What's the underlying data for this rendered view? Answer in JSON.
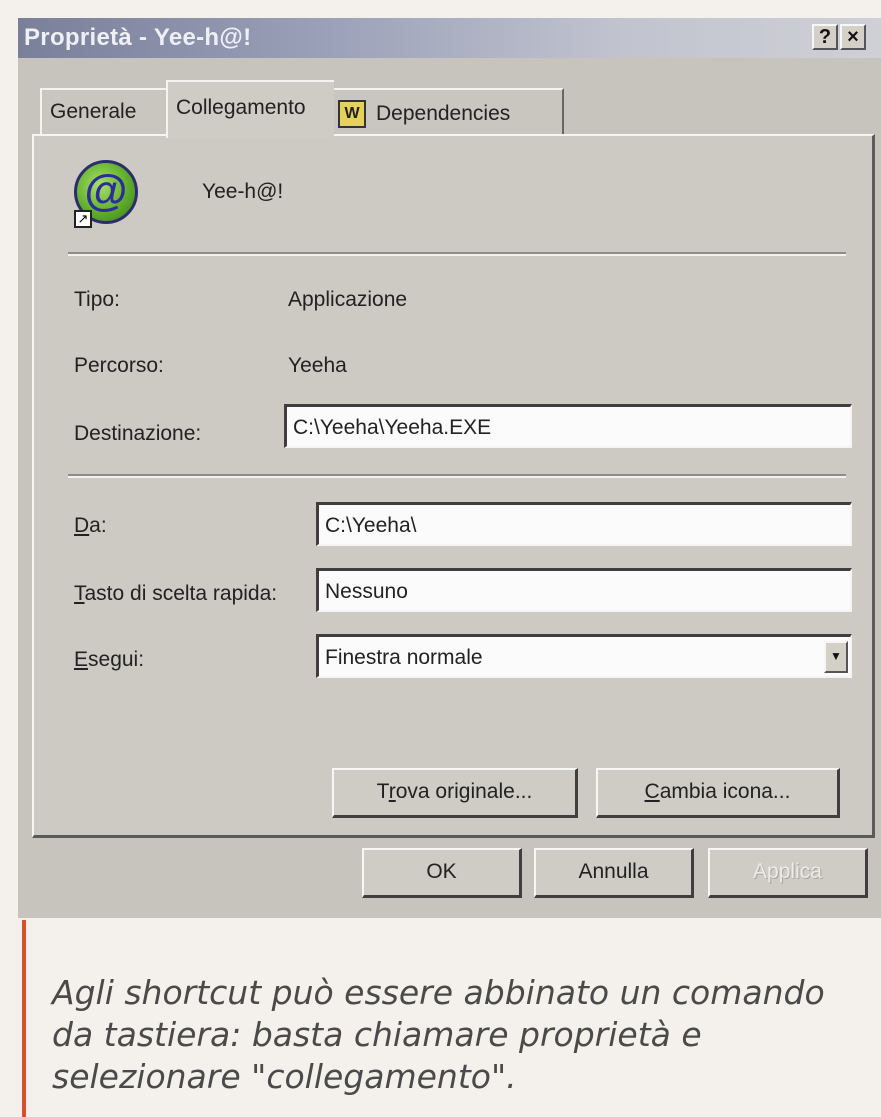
{
  "window": {
    "title": "Proprietà - Yee-h@!",
    "help_label": "?",
    "close_label": "×"
  },
  "tabs": [
    {
      "label": "Generale"
    },
    {
      "label": "Collegamento"
    },
    {
      "label": "Dependencies",
      "icon": "dependencies-icon"
    }
  ],
  "shortcut": {
    "icon": "yeeha-app-icon",
    "name": "Yee-h@!",
    "tipo_label": "Tipo:",
    "tipo_value": "Applicazione",
    "percorso_label": "Percorso:",
    "percorso_value": "Yeeha",
    "destinazione_label": "Destinazione:",
    "destinazione_value": "C:\\Yeeha\\Yeeha.EXE",
    "da_label_key": "D",
    "da_label_rest": "a:",
    "da_value": "C:\\Yeeha\\",
    "tasto_label_key": "T",
    "tasto_label_rest": "asto di scelta rapida:",
    "tasto_value": "Nessuno",
    "esegui_label_key": "E",
    "esegui_label_rest": "segui:",
    "esegui_value": "Finestra normale"
  },
  "buttons": {
    "trova_key": "r",
    "trova_pre": "T",
    "trova_post": "ova originale...",
    "cambia_key": "C",
    "cambia_post": "ambia icona...",
    "ok": "OK",
    "annulla": "Annulla",
    "applica": "Applica"
  },
  "caption": "Agli shortcut può essere abbinato un comando da tastiera: basta chiamare proprietà e selezionare \"collegamento\"."
}
